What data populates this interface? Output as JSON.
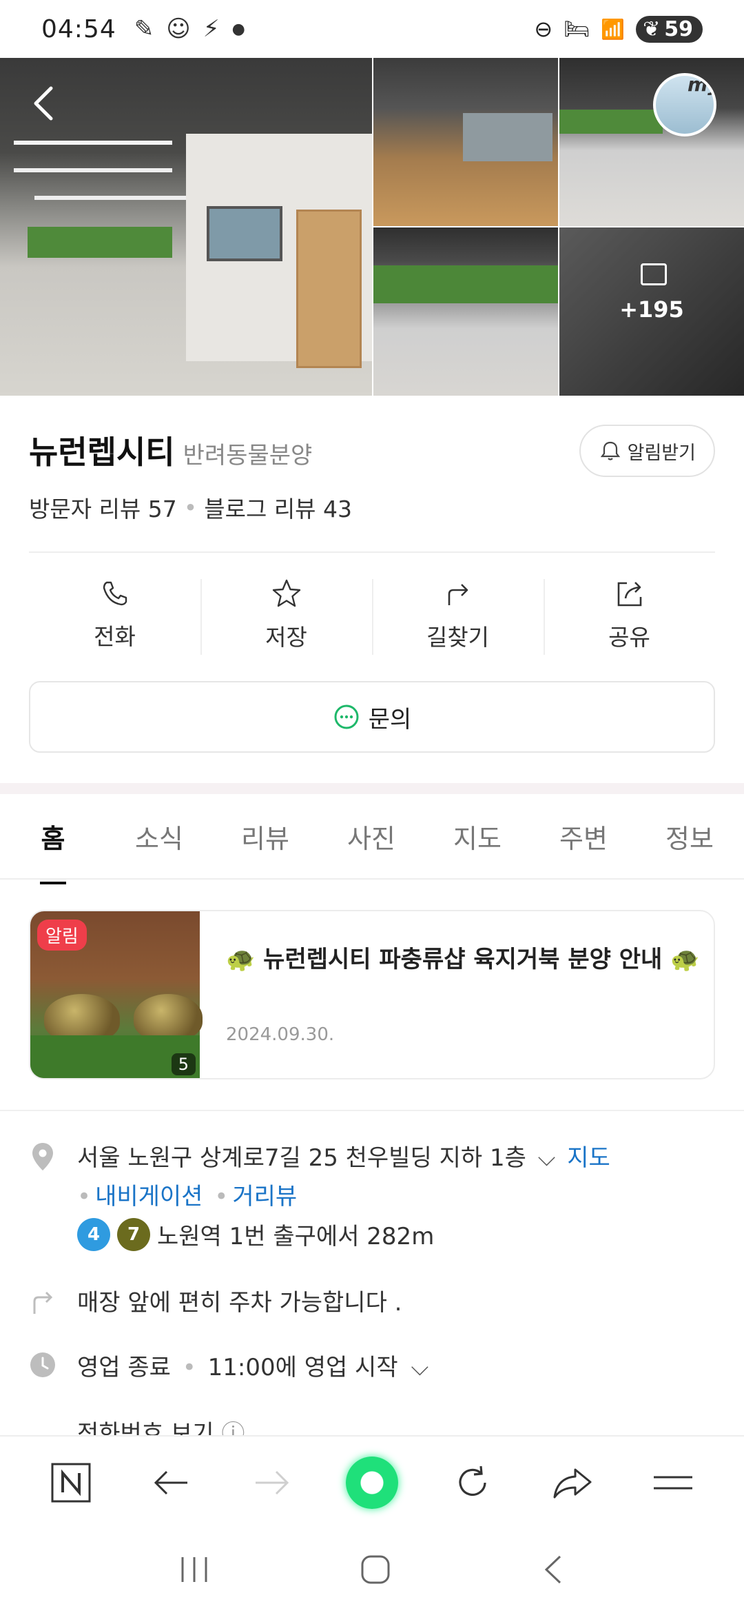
{
  "status_bar": {
    "time": "04:54",
    "battery": "59"
  },
  "gallery": {
    "more_count": "+195",
    "my_badge": "my"
  },
  "place": {
    "name": "뉴런렙시티",
    "category": "반려동물분양",
    "alarm_button": "알림받기",
    "visitor_reviews": "방문자 리뷰 57",
    "blog_reviews": "블로그 리뷰 43"
  },
  "actions": [
    {
      "label": "전화",
      "icon": "phone-icon"
    },
    {
      "label": "저장",
      "icon": "star-icon"
    },
    {
      "label": "길찾기",
      "icon": "directions-icon"
    },
    {
      "label": "공유",
      "icon": "share-icon"
    }
  ],
  "inquiry_label": "문의",
  "tabs": [
    "홈",
    "소식",
    "리뷰",
    "사진",
    "지도",
    "주변",
    "정보"
  ],
  "notice": {
    "badge": "알림",
    "photo_count": "5",
    "title": "🐢 뉴런렙시티 파충류샵 육지거북 분양 안내 🐢",
    "date": "2024.09.30."
  },
  "info": {
    "address": "서울 노원구 상계로7길 25 천우빌딩 지하 1층",
    "map_link": "지도",
    "navigation_link": "내비게이션",
    "street_view_link": "거리뷰",
    "subway_lines": [
      {
        "number": "4",
        "color": "#2f9be0"
      },
      {
        "number": "7",
        "color": "#6b6b1e"
      }
    ],
    "subway_text": "노원역 1번 출구에서 282m",
    "parking": "매장 앞에 편히 주차 가능합니다 .",
    "hours_status": "영업 종료",
    "hours_text": "11:00에 영업 시작",
    "phone_view": "전화번호 보기"
  }
}
